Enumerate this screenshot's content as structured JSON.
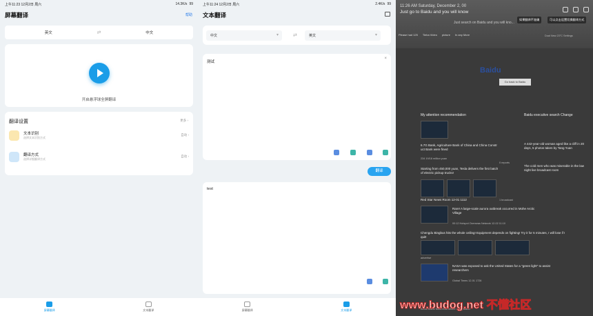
{
  "pane1": {
    "status_time": "上午11:23 12月2日 周六",
    "status_right": "14.3K/s",
    "battery": "99",
    "title": "屏幕翻译",
    "help": "帮助",
    "source_lang": "英文",
    "target_lang": "中文",
    "start_hint": "开启悬浮球全屏翻译",
    "settings_title": "翻译设置",
    "settings_more": "更多",
    "settings_items": [
      {
        "title": "文本识别",
        "subtitle": "选择文本识别方式",
        "value": "自动"
      },
      {
        "title": "翻译方式",
        "subtitle": "选择详细翻译方式",
        "value": "自动"
      }
    ],
    "nav": [
      "屏幕翻译",
      "文本翻译"
    ]
  },
  "pane2": {
    "status_time": "上午11:24 12月2日 周六",
    "status_right": "2.4K/s",
    "battery": "99",
    "title": "文本翻译",
    "source_lang": "中文",
    "target_lang": "英文",
    "input_text": "测试",
    "translate_button": "翻译",
    "output_text": "test",
    "nav": [
      "屏幕翻译",
      "文本翻译"
    ]
  },
  "pane3": {
    "time_line": "11:26 AM Saturday, December 2, 00",
    "headline": "Just go to Baidu and you will know",
    "url_hint": "Just search on Baidu and you will kno...",
    "menu_1": "如果翻译不准确",
    "menu_2": "可以点击设置切换翻译方式",
    "tabs": [
      "Please had 125",
      "Tieba Video",
      "picture",
      "In any More"
    ],
    "weather": "Dual New 23°C Settings",
    "logo": "Baidu",
    "search_button": "Go back to Baidu",
    "feed_title": "My attention recommendation",
    "feed_right_title": "Baidu executive search",
    "feed_change": "Change",
    "feed_items": [
      {
        "text": "6.7G Bank, Agriculture Bank of China and China Constr uct Bank were fined",
        "meta": "234 19/18 million yuan"
      },
      {
        "text": "Starting from 450,000 yuan, Tesla delivers the first batch of electric pickup trucks!",
        "meta": "0 reports"
      },
      {
        "text": "Red Star News Room 12-01 1112",
        "meta": "1 broadcast"
      },
      {
        "text": "Rare! A large-scale aurora outbreak occurred in Mohe Arctic Village",
        "meta": "00:12 Hotspot Overseas Network 12-02 11:10"
      },
      {
        "text": "Chengdu Bingbus hits the whole ceiling! Equipment depends on fighting! Try it for 5 minutes, I will lose if I quit!",
        "meta": "advertise"
      },
      {
        "text": "NASA was exposed to ask the United States for a \"green light\" to assist researchers",
        "meta": "Global Times 12-01 1726"
      }
    ],
    "right_items": [
      "A 442-year-old woman aged like a cliff in 20 days, 5 photos taken by Tang Yuan",
      "The cold men who was miserable in the law night live broadcast room"
    ],
    "footer": "About Baidu Must-read before using Baidu",
    "watermark": "www.budog.net 不懂社区"
  }
}
